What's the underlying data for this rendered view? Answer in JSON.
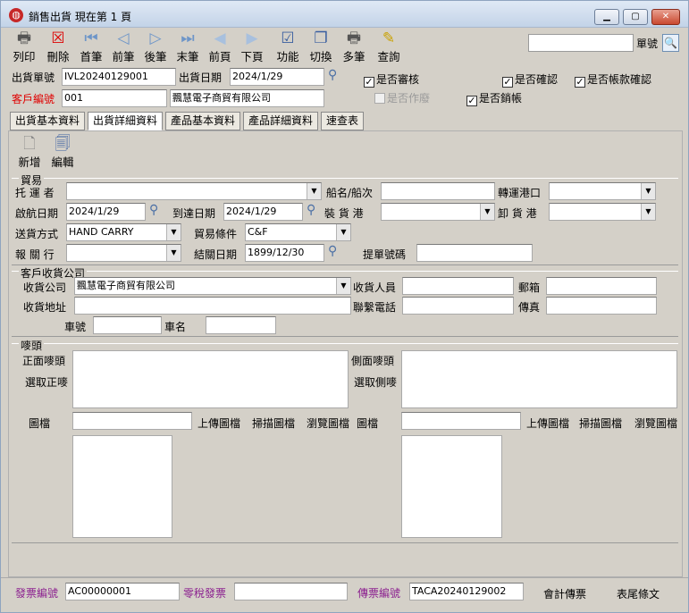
{
  "window": {
    "title": "銷售出貨  現在第 1 頁"
  },
  "toolbar": {
    "buttons": [
      {
        "label": "列印",
        "icon": "printer-icon"
      },
      {
        "label": "刪除",
        "icon": "delete-icon"
      },
      {
        "label": "首筆",
        "icon": "first-icon"
      },
      {
        "label": "前筆",
        "icon": "prev-icon"
      },
      {
        "label": "後筆",
        "icon": "next-icon"
      },
      {
        "label": "末筆",
        "icon": "last-icon"
      },
      {
        "label": "前頁",
        "icon": "prev-page-icon"
      },
      {
        "label": "下頁",
        "icon": "next-page-icon"
      },
      {
        "label": "功能",
        "icon": "function-icon"
      },
      {
        "label": "切換",
        "icon": "switch-icon"
      },
      {
        "label": "多筆",
        "icon": "multi-icon"
      },
      {
        "label": "查詢",
        "icon": "query-icon"
      }
    ],
    "search_label": "單號",
    "search_value": ""
  },
  "header": {
    "order_no_label": "出貨單號",
    "order_no": "IVL20240129001",
    "ship_date_label": "出貨日期",
    "ship_date": "2024/1/29",
    "customer_no_label": "客戶編號",
    "customer_no": "001",
    "customer_name": "飄慧電子商貿有限公司",
    "checks": {
      "audited": {
        "label": "是否審核",
        "checked": true
      },
      "confirmed": {
        "label": "是否確認",
        "checked": true
      },
      "account_confirmed": {
        "label": "是否帳款確認",
        "checked": true
      },
      "voided": {
        "label": "是否作廢",
        "checked": false
      },
      "closed": {
        "label": "是否銷帳",
        "checked": true
      }
    }
  },
  "tabs": [
    "出貨基本資料",
    "出貨詳細資料",
    "產品基本資料",
    "產品詳細資料",
    "速查表"
  ],
  "panel_tools": [
    {
      "label": "新增",
      "icon": "new-doc-icon"
    },
    {
      "label": "編輯",
      "icon": "edit-icon"
    }
  ],
  "trade": {
    "title": "貿易",
    "carrier_label": "托 運 者",
    "carrier": "",
    "ship_name_label": "船名/船次",
    "ship_name": "",
    "transit_port_label": "轉運港口",
    "transit_port": "",
    "depart_date_label": "啟航日期",
    "depart_date": "2024/1/29",
    "arrive_date_label": "到達日期",
    "arrive_date": "2024/1/29",
    "load_port_label": "裝 貨 港",
    "load_port": "",
    "unload_port_label": "卸 貨 港",
    "unload_port": "",
    "ship_method_label": "送貨方式",
    "ship_method": "HAND CARRY",
    "terms_label": "貿易條件",
    "terms": "C&F",
    "broker_label": "報 關 行",
    "broker": "",
    "customs_date_label": "結關日期",
    "customs_date": "1899/12/30",
    "bl_no_label": "提單號碼",
    "bl_no": ""
  },
  "receiver": {
    "title": "客戶收貨公司",
    "company_label": "收貨公司",
    "company": "飄慧電子商貿有限公司",
    "person_label": "收貨人員",
    "person": "",
    "mailbox_label": "郵箱",
    "mailbox": "",
    "address_label": "收貨地址",
    "address": "",
    "phone_label": "聯繫電話",
    "phone": "",
    "fax_label": "傳真",
    "fax": "",
    "car_no_label": "車號",
    "car_no": "",
    "car_name_label": "車名",
    "car_name": ""
  },
  "mark": {
    "title": "嘜頭",
    "front_label": "正面嘜頭",
    "select_front_label": "選取正嘜",
    "side_label": "側面嘜頭",
    "select_side_label": "選取側嘜",
    "image_label": "圖檔",
    "upload_label": "上傳圖檔",
    "scan_label": "掃描圖檔",
    "browse_label": "瀏覽圖檔"
  },
  "footer": {
    "invoice_no_label": "發票編號",
    "invoice_no": "AC00000001",
    "zero_tax_label": "零稅發票",
    "zero_tax": "",
    "voucher_no_label": "傳票編號",
    "voucher_no": "TACA20240129002",
    "accounting_label": "會計傳票",
    "footer_text_label": "表尾條文"
  }
}
